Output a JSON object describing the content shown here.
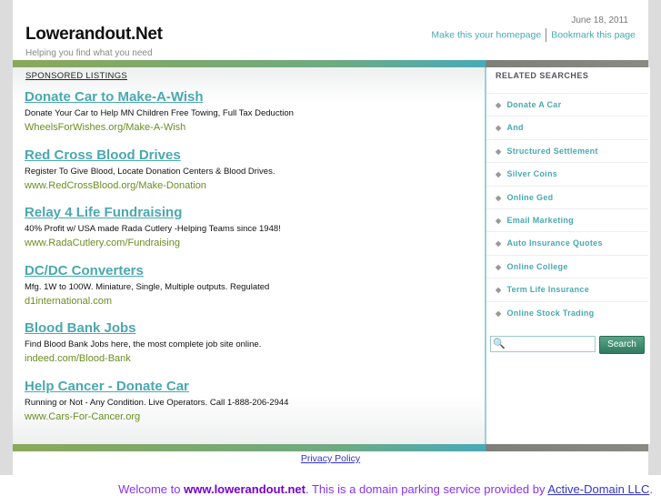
{
  "header": {
    "date": "June 18, 2011",
    "homepage_link": "Make this your homepage",
    "bookmark_link": "Bookmark this page",
    "site_title": "Lowerandout.Net",
    "tagline": "Helping you find what you need"
  },
  "sponsored": {
    "heading": "SPONSORED LISTINGS",
    "ads": [
      {
        "title": "Donate Car to Make-A-Wish",
        "desc": "Donate Your Car to Help MN Children Free Towing, Full Tax Deduction",
        "url": "WheelsForWishes.org/Make-A-Wish"
      },
      {
        "title": "Red Cross Blood Drives",
        "desc": "Register To Give Blood, Locate Donation Centers & Blood Drives.",
        "url": "www.RedCrossBlood.org/Make-Donation"
      },
      {
        "title": "Relay 4 Life Fundraising",
        "desc": "40% Profit w/ USA made Rada Cutlery -Helping Teams since 1948!",
        "url": "www.RadaCutlery.com/Fundraising"
      },
      {
        "title": "DC/DC Converters",
        "desc": "Mfg. 1W to 100W. Miniature, Single, Multiple outputs. Regulated",
        "url": "d1international.com"
      },
      {
        "title": "Blood Bank Jobs",
        "desc": "Find Blood Bank Jobs here, the most complete job site online.",
        "url": "indeed.com/Blood-Bank"
      },
      {
        "title": "Help Cancer - Donate Car",
        "desc": "Running or Not - Any Condition. Live Operators. Call 1-888-206-2944",
        "url": "www.Cars-For-Cancer.org"
      }
    ]
  },
  "related": {
    "heading": "RELATED SEARCHES",
    "items": [
      "Donate A Car",
      "And",
      "Structured Settlement",
      "Silver Coins",
      "Online Ged",
      "Email Marketing",
      "Auto Insurance Quotes",
      "Online College",
      "Term Life Insurance",
      "Online Stock Trading"
    ],
    "search_button": "Search",
    "search_value": ""
  },
  "footer": {
    "privacy": "Privacy Policy",
    "welcome_prefix": "Welcome to ",
    "welcome_domain": "www.lowerandout.net",
    "welcome_mid": ". This is a domain parking service provided by ",
    "provider": "Active-Domain LLC",
    "welcome_end": "."
  }
}
